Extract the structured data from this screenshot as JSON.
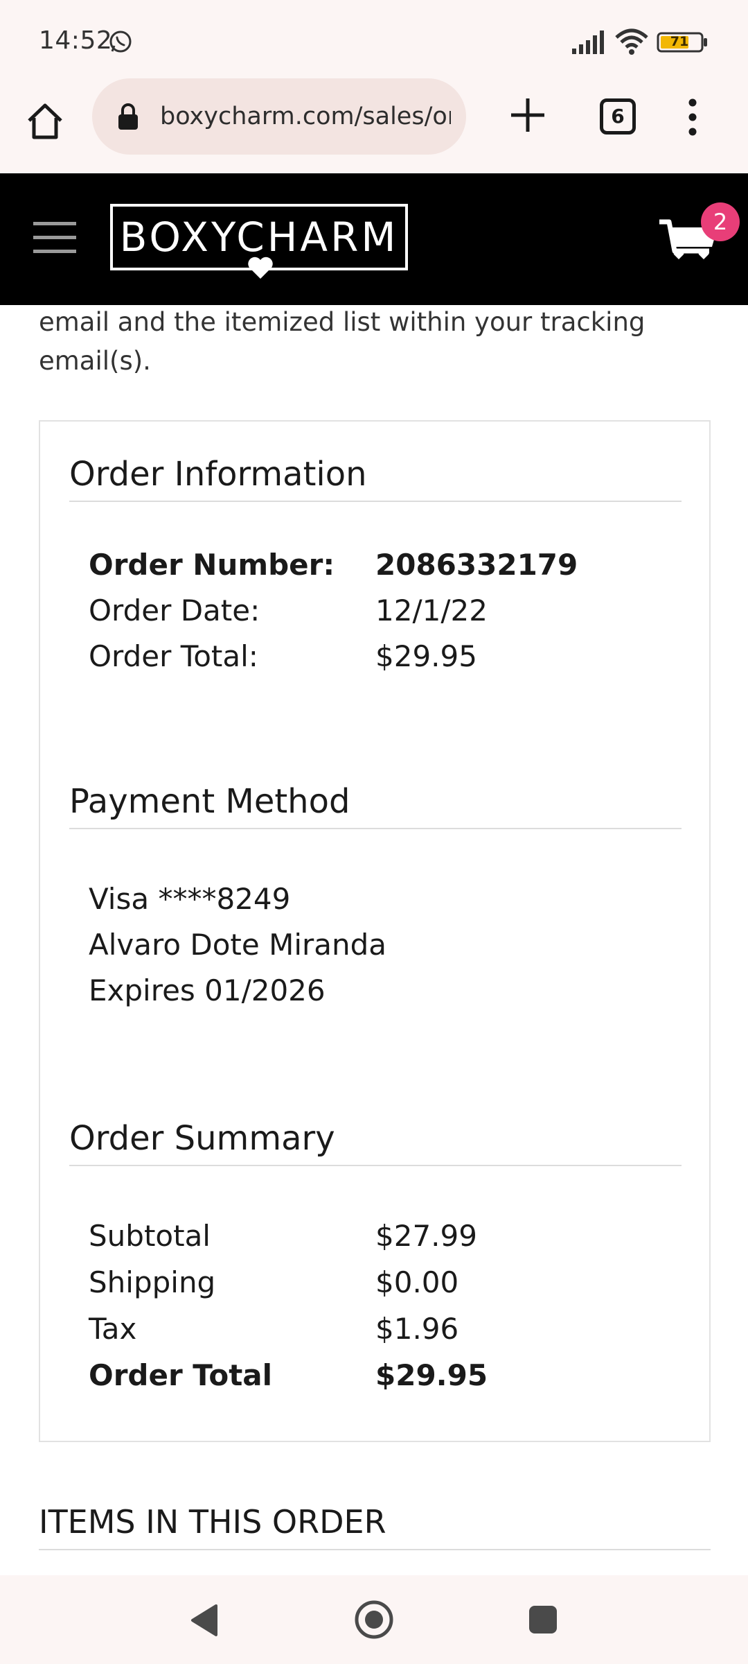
{
  "status_bar": {
    "time": "14:52",
    "battery_level": "71",
    "icons": [
      "whatsapp-icon",
      "signal-icon",
      "wifi-icon",
      "battery-icon"
    ]
  },
  "browser": {
    "url": "boxycharm.com/sales/order/view/",
    "tab_count": "6",
    "icons": [
      "home-icon",
      "lock-icon",
      "plus-icon",
      "more-vert-icon"
    ]
  },
  "site_header": {
    "logo_text": "BOXYCHARM",
    "cart_count": "2",
    "icons": [
      "hamburger-icon",
      "heart-icon",
      "cart-icon"
    ]
  },
  "intro": {
    "text": "email and the itemized list within your tracking email(s)."
  },
  "order_information": {
    "title": "Order Information",
    "rows": [
      {
        "label": "Order Number:",
        "value": "2086332179"
      },
      {
        "label": "Order Date:",
        "value": "12/1/22"
      },
      {
        "label": "Order Total:",
        "value": "$29.95"
      }
    ]
  },
  "payment_method": {
    "title": "Payment Method",
    "card": "Visa ****8249",
    "name": "Alvaro Dote Miranda",
    "expires": "Expires 01/2026"
  },
  "order_summary": {
    "title": "Order Summary",
    "rows": [
      {
        "label": "Subtotal",
        "value": "$27.99"
      },
      {
        "label": "Shipping",
        "value": "$0.00"
      },
      {
        "label": "Tax",
        "value": "$1.96"
      },
      {
        "label": "Order Total",
        "value": "$29.95"
      }
    ]
  },
  "items_heading": "ITEMS IN THIS ORDER",
  "colors": {
    "header_bg": "#000000",
    "badge": "#e83e78",
    "chrome_bg": "#fcf5f4",
    "url_pill": "#f3e4e1"
  },
  "nav_bar": {
    "icons": [
      "back-icon",
      "home-circle-icon",
      "recents-icon"
    ]
  }
}
